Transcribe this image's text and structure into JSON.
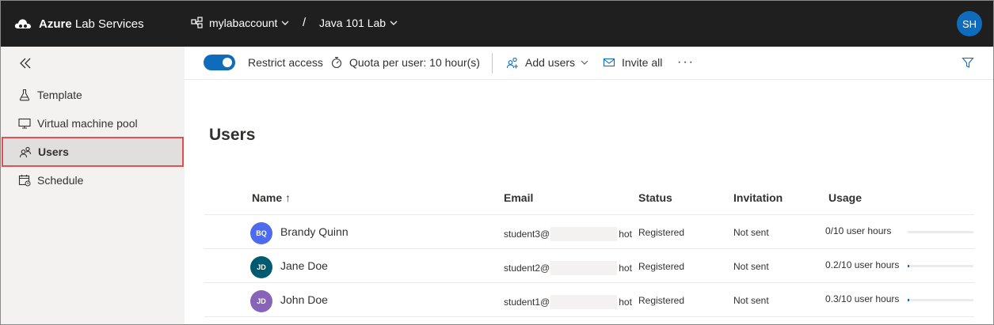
{
  "header": {
    "brand_bold": "Azure",
    "brand_rest": " Lab Services",
    "account": "mylabaccount",
    "separator": "/",
    "lab": "Java 101 Lab",
    "avatar_initials": "SH"
  },
  "sidebar": {
    "items": [
      {
        "label": "Template",
        "icon": "flask-icon"
      },
      {
        "label": "Virtual machine pool",
        "icon": "monitor-icon"
      },
      {
        "label": "Users",
        "icon": "users-icon",
        "active": true
      },
      {
        "label": "Schedule",
        "icon": "calendar-icon"
      }
    ]
  },
  "toolbar": {
    "restrict_label": "Restrict access",
    "restrict_on": true,
    "quota_label": "Quota per user: 10 hour(s)",
    "add_users_label": "Add users",
    "invite_all_label": "Invite all",
    "more_label": "···"
  },
  "main": {
    "title": "Users",
    "columns": {
      "name": "Name ↑",
      "email": "Email",
      "status": "Status",
      "invitation": "Invitation",
      "usage": "Usage"
    },
    "rows": [
      {
        "initials": "BQ",
        "color": "#4f6bed",
        "name": "Brandy Quinn",
        "email_prefix": "student3@",
        "email_suffix": "hot",
        "status": "Registered",
        "invitation": "Not sent",
        "usage": "0/10 user hours",
        "usage_fraction": 0.0
      },
      {
        "initials": "JD",
        "color": "#005b70",
        "name": "Jane Doe",
        "email_prefix": "student2@",
        "email_suffix": "hot",
        "status": "Registered",
        "invitation": "Not sent",
        "usage": "0.2/10 user hours",
        "usage_fraction": 0.02
      },
      {
        "initials": "JD",
        "color": "#8764b8",
        "name": "John Doe",
        "email_prefix": "student1@",
        "email_suffix": "hot",
        "status": "Registered",
        "invitation": "Not sent",
        "usage": "0.3/10 user hours",
        "usage_fraction": 0.03
      }
    ]
  },
  "colors": {
    "accent": "#0f6cbd",
    "topbar": "#1f1f1f",
    "highlight_border": "#e05252"
  }
}
